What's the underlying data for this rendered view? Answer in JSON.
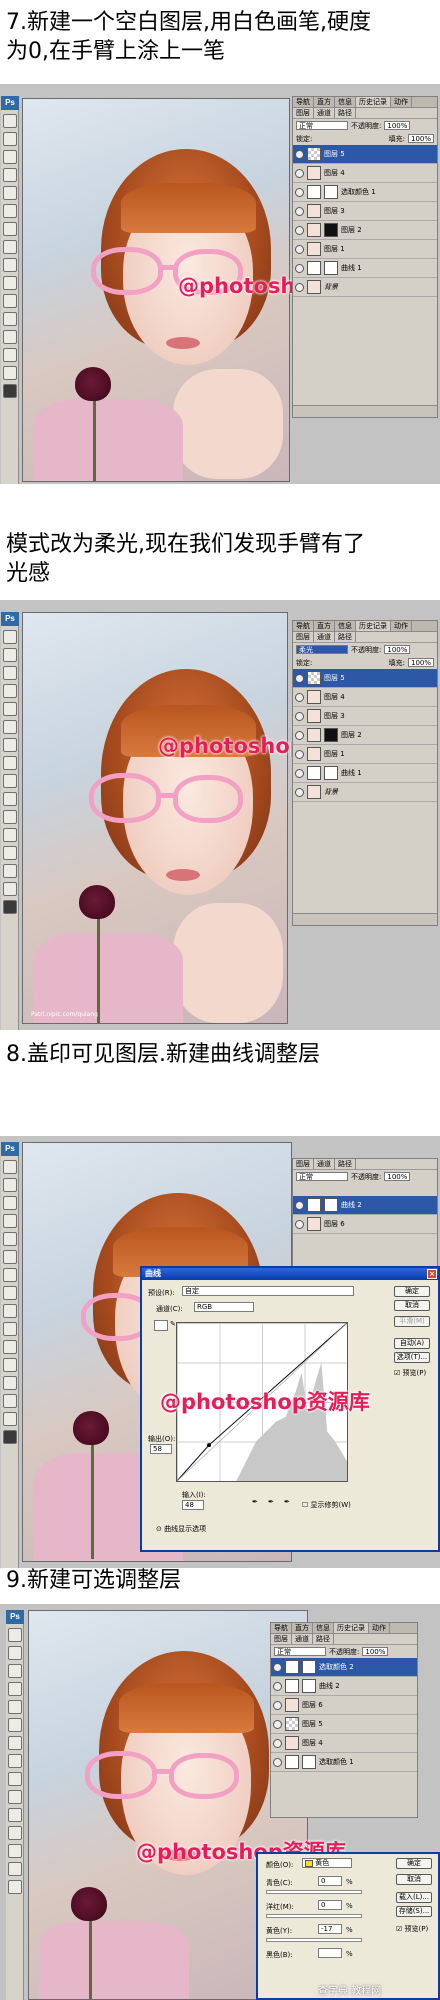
{
  "steps": [
    {
      "heading_lines": [
        "7.新建一个空白图层,用白色画笔,硬度",
        "为0,在手臂上涂上一笔"
      ],
      "watermark": "@photoshop资源库",
      "panel": {
        "tabs": [
          "图层",
          "通道",
          "路径"
        ],
        "top_tabs": [
          "导航",
          "直方",
          "信息",
          "历史记录",
          "动作"
        ],
        "blend_mode": "正常",
        "opacity_label": "不透明度:",
        "opacity": "100%",
        "lock_label": "锁定:",
        "fill_label": "填充:",
        "fill": "100%",
        "layers": [
          {
            "name": "图层 5",
            "selected": true
          },
          {
            "name": "图层 4",
            "selected": false
          },
          {
            "name": "选取颜色 1",
            "selected": false
          },
          {
            "name": "图层 3",
            "selected": false
          },
          {
            "name": "图层 2",
            "selected": false
          },
          {
            "name": "图层 1",
            "selected": false
          },
          {
            "name": "曲线 1",
            "selected": false
          },
          {
            "name": "背景",
            "selected": false
          }
        ]
      }
    },
    {
      "heading_lines": [
        "模式改为柔光,现在我们发现手臂有了",
        "光感"
      ],
      "watermark": "@photoshop资源库",
      "photo_credit": "Patrl.nipic.com/quiang",
      "panel": {
        "top_tabs": [
          "导航",
          "直方",
          "信息",
          "历史记录",
          "动作"
        ],
        "tabs": [
          "图层",
          "通道",
          "路径"
        ],
        "blend_mode": "柔光",
        "opacity_label": "不透明度:",
        "opacity": "100%",
        "lock_label": "锁定:",
        "fill_label": "填充:",
        "fill": "100%",
        "layers": [
          {
            "name": "图层 5",
            "selected": true
          },
          {
            "name": "图层 4",
            "selected": false
          },
          {
            "name": "图层 3",
            "selected": false
          },
          {
            "name": "图层 2",
            "selected": false
          },
          {
            "name": "图层 1",
            "selected": false
          },
          {
            "name": "曲线 1",
            "selected": false
          },
          {
            "name": "背景",
            "selected": false
          }
        ]
      }
    },
    {
      "heading_lines": [
        "8.盖印可见图层.新建曲线调整层"
      ],
      "watermark": "@photoshop资源库",
      "panel": {
        "tabs": [
          "图层",
          "通道",
          "路径"
        ],
        "blend_mode": "正常",
        "opacity_label": "不透明度:",
        "opacity": "100%",
        "layers": [
          {
            "name": "曲线 2",
            "selected": true
          },
          {
            "name": "图层 6",
            "selected": false
          }
        ]
      },
      "curves_dialog": {
        "title": "曲线",
        "preset_label": "预设(R):",
        "preset_value": "自定",
        "channel_label": "通道(C):",
        "channel_value": "RGB",
        "output_label": "输出(O):",
        "output_value": "58",
        "input_label": "输入(I):",
        "input_value": "48",
        "show_clipping": "显示修剪(W)",
        "curve_options": "曲线显示选项",
        "buttons": [
          "确定",
          "取消",
          "平滑(M)",
          "自动(A)",
          "选项(T)...",
          "预览(P)"
        ],
        "curve_points": [
          [
            0,
            0
          ],
          [
            48,
            58
          ],
          [
            255,
            255
          ]
        ]
      }
    },
    {
      "heading_lines": [
        "9.新建可选调整层"
      ],
      "watermark": "@photoshop资源库",
      "panel": {
        "top_tabs": [
          "导航",
          "直方",
          "信息",
          "历史记录",
          "动作"
        ],
        "tabs": [
          "图层",
          "通道",
          "路径"
        ],
        "blend_mode": "正常",
        "opacity_label": "不透明度:",
        "opacity": "100%",
        "layers": [
          {
            "name": "选取颜色 2",
            "selected": true
          },
          {
            "name": "曲线 2",
            "selected": false
          },
          {
            "name": "图层 6",
            "selected": false
          },
          {
            "name": "图层 5",
            "selected": false
          },
          {
            "name": "图层 4",
            "selected": false
          },
          {
            "name": "选取颜色 1",
            "selected": false
          }
        ]
      },
      "selective_dialog": {
        "color_label": "颜色(O):",
        "color_value": "黄色",
        "rows": [
          {
            "label": "青色(C):",
            "value": "0",
            "unit": "%"
          },
          {
            "label": "洋红(M):",
            "value": "0",
            "unit": "%"
          },
          {
            "label": "黄色(Y):",
            "value": "-17",
            "unit": "%"
          },
          {
            "label": "黑色(B):",
            "value": "",
            "unit": "%"
          }
        ],
        "buttons": [
          "确定",
          "取消",
          "载入(L)...",
          "存储(S)..."
        ],
        "preview": "预览(P)"
      }
    }
  ],
  "footer_watermark": "查字典 教程网"
}
